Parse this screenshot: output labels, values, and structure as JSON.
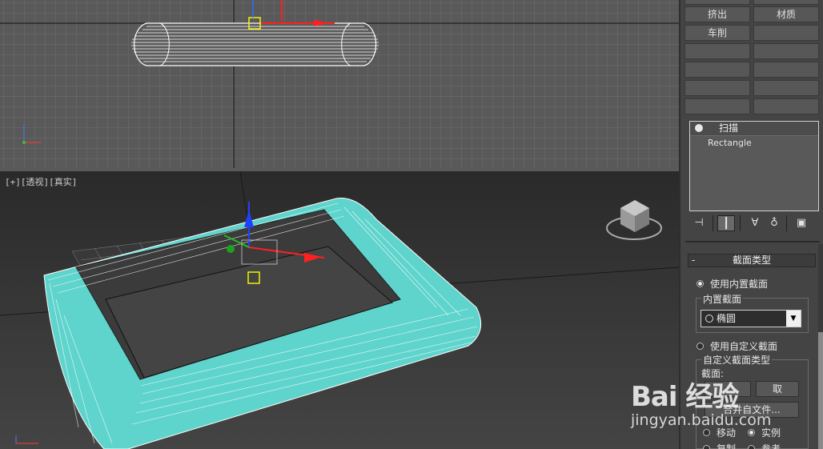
{
  "command_panel": {
    "buttons": [
      {
        "label": "挤出"
      },
      {
        "label": "材质"
      },
      {
        "label": "车削"
      },
      {
        "label": ""
      },
      {
        "label": ""
      },
      {
        "label": ""
      },
      {
        "label": ""
      },
      {
        "label": ""
      },
      {
        "label": ""
      },
      {
        "label": ""
      }
    ],
    "modifier_stack": {
      "top_item": "扫描",
      "sub_item": "Rectangle"
    }
  },
  "viewports": {
    "perspective_label": {
      "plus": "[+]",
      "mode": "[透视]",
      "shading": "[真实]"
    }
  },
  "rollout": {
    "title": "截面类型",
    "collapse_symbol": "-",
    "use_builtin_label": "使用内置截面",
    "builtin_group_title": "内置截面",
    "builtin_selected": "椭圆",
    "use_custom_label": "使用自定义截面",
    "custom_group_title": "自定义截面类型",
    "section_label": "截面:",
    "pick_button": "取",
    "merge_button": "合并自文件...",
    "move_label": "移动",
    "instance_label": "实例",
    "copy_label": "复制",
    "reference_label": "参考"
  },
  "watermark": {
    "logo": "Bai 经验",
    "url": "jingyan.baidu.com"
  },
  "colors": {
    "object": "#5fd4cc",
    "selection": "#ffff00",
    "axis_x": "#ff2020",
    "axis_y": "#20c020",
    "axis_z": "#2040ff"
  }
}
